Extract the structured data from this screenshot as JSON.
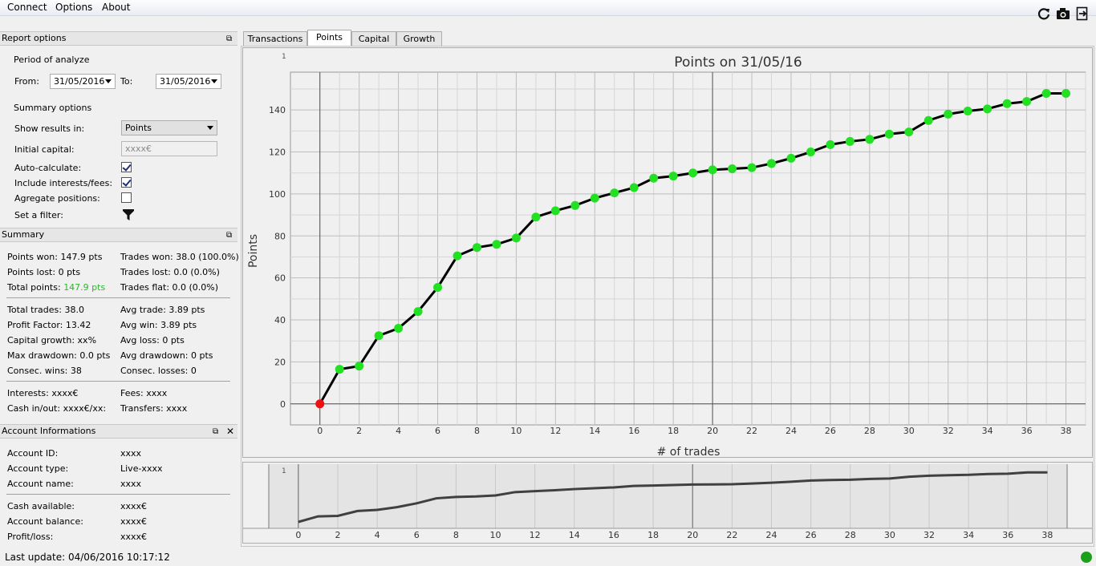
{
  "menu": {
    "items": [
      "Connect",
      "Options",
      "About"
    ]
  },
  "toolbar": {
    "icons": [
      "refresh-icon",
      "camera-icon",
      "export-icon"
    ]
  },
  "report_options": {
    "title": "Report options",
    "period_label": "Period of analyze",
    "from_label": "From:",
    "from_value": "31/05/2016",
    "to_label": "To:",
    "to_value": "31/05/2016",
    "summary_label": "Summary options",
    "show_results_label": "Show results in:",
    "show_results_value": "Points",
    "initial_capital_label": "Initial capital:",
    "initial_capital_placeholder": "xxxx€",
    "auto_calculate_label": "Auto-calculate:",
    "auto_calculate_checked": true,
    "include_interests_label": "Include interests/fees:",
    "include_interests_checked": true,
    "aggregate_label": "Agregate positions:",
    "aggregate_checked": false,
    "filter_label": "Set a filter:"
  },
  "summary": {
    "title": "Summary",
    "points_won": "Points won: 147.9 pts",
    "points_lost": "Points lost: 0 pts",
    "total_points_label": "Total points:",
    "total_points_value": "147.9 pts",
    "trades_won": "Trades won: 38.0 (100.0%)",
    "trades_lost": "Trades lost: 0.0 (0.0%)",
    "trades_flat": "Trades flat: 0.0 (0.0%)",
    "total_trades": "Total trades: 38.0",
    "profit_factor": "Profit Factor: 13.42",
    "capital_growth": "Capital growth: xx%",
    "max_drawdown": "Max drawdown: 0.0 pts",
    "consec_wins": "Consec. wins: 38",
    "avg_trade": "Avg trade: 3.89 pts",
    "avg_win": "Avg win: 3.89 pts",
    "avg_loss": "Avg loss: 0 pts",
    "avg_drawdown": "Avg drawdown: 0 pts",
    "consec_losses": "Consec. losses: 0",
    "interests": "Interests: xxxx€",
    "fees": "Fees: xxxx",
    "cash_inout": "Cash in/out: xxxx€/xx:",
    "transfers": "Transfers: xxxx",
    "accent_color": "#2db52d"
  },
  "account": {
    "title": "Account Informations",
    "rows": [
      {
        "label": "Account ID:",
        "value": "xxxx"
      },
      {
        "label": "Account type:",
        "value": "Live-xxxx"
      },
      {
        "label": "Account name:",
        "value": "xxxx"
      },
      {
        "label": "Cash available:",
        "value": "xxxx€"
      },
      {
        "label": "Account balance:",
        "value": "xxxx€"
      },
      {
        "label": "Profit/loss:",
        "value": "xxxx€"
      }
    ]
  },
  "tabs": [
    "Transactions",
    "Points",
    "Capital",
    "Growth"
  ],
  "active_tab": "Points",
  "status": {
    "last_update": "Last update: 04/06/2016 10:17:12",
    "led_color": "#1aa01a"
  },
  "chart_data": {
    "type": "line",
    "title": "Points on 31/05/16",
    "xlabel": "# of trades",
    "ylabel": "Points",
    "corner_label": "1",
    "xlim": [
      -1.5,
      39
    ],
    "ylim": [
      -10,
      158
    ],
    "xticks": [
      0,
      2,
      4,
      6,
      8,
      10,
      12,
      14,
      16,
      18,
      20,
      22,
      24,
      26,
      28,
      30,
      32,
      34,
      36,
      38
    ],
    "yticks": [
      0,
      20,
      40,
      60,
      80,
      100,
      120,
      140
    ],
    "grid": true,
    "line_color": "#000000",
    "point_color": "#22e022",
    "start_point_color": "#ee1111",
    "x": [
      0,
      1,
      2,
      3,
      4,
      5,
      6,
      7,
      8,
      9,
      10,
      11,
      12,
      13,
      14,
      15,
      16,
      17,
      18,
      19,
      20,
      21,
      22,
      23,
      24,
      25,
      26,
      27,
      28,
      29,
      30,
      31,
      32,
      33,
      34,
      35,
      36,
      37,
      38
    ],
    "y": [
      0,
      16.5,
      18,
      32.5,
      36,
      44,
      55.5,
      70.5,
      74.5,
      76,
      79,
      89,
      92,
      94.5,
      98,
      100.5,
      103,
      107.5,
      108.5,
      110,
      111.5,
      112,
      112.5,
      114.5,
      117,
      120,
      123.5,
      125,
      126,
      128.5,
      129.5,
      135,
      138,
      139.5,
      140.5,
      143,
      144,
      147.9,
      147.9
    ]
  }
}
